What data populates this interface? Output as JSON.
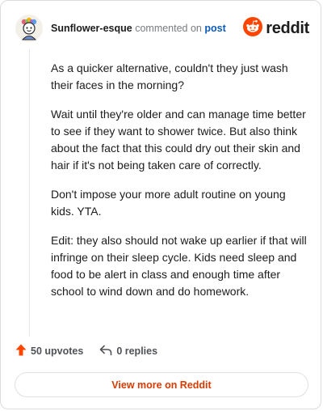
{
  "header": {
    "username": "Sunflower-esque",
    "commented_text": "commented on",
    "post_link": "post",
    "brand": "reddit"
  },
  "comment": {
    "paragraphs": [
      "As a quicker alternative, couldn't they just wash their faces in the morning?",
      "Wait until they're older and can manage time better to see if they want to shower twice. But also think about the fact that this could dry out their skin and hair if it's not being taken care of correctly.",
      "Don't impose your more adult routine on young kids. YTA.",
      "Edit: they also should not wake up earlier if that will infringe on their sleep cycle. Kids need sleep and food to be alert in class and enough time after school to wind down and do homework."
    ]
  },
  "actions": {
    "upvotes": "50 upvotes",
    "replies": "0 replies",
    "upvote_icon": "upvote-arrow-icon",
    "reply_icon": "reply-arrow-icon"
  },
  "footer": {
    "view_more": "View more on Reddit"
  },
  "colors": {
    "brand_orange": "#ff4500",
    "link_blue": "#0b5bb5",
    "cta_orange": "#d93a00"
  }
}
